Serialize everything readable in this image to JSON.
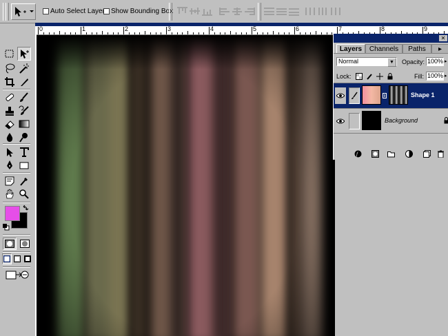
{
  "options_bar": {
    "auto_select_label": "Auto Select Layer",
    "show_bounding_label": "Show Bounding Box",
    "auto_select_checked": false,
    "show_bounding_checked": false
  },
  "ruler": {
    "numbers": [
      "0",
      "1",
      "2",
      "3",
      "4",
      "5",
      "6",
      "7",
      "8",
      "9"
    ]
  },
  "toolbox": {
    "foreground_color": "#e64ee8",
    "background_color": "#000000"
  },
  "layers_panel": {
    "tabs": [
      "Layers",
      "Channels",
      "Paths"
    ],
    "active_tab": "Layers",
    "blend_mode": "Normal",
    "opacity_label": "Opacity:",
    "opacity_value": "100%",
    "lock_label": "Lock:",
    "fill_label": "Fill:",
    "fill_value": "100%",
    "layers": [
      {
        "name": "Shape 1",
        "selected": true,
        "visible": true
      },
      {
        "name": "Background",
        "selected": false,
        "visible": true
      }
    ]
  },
  "colors": {
    "ui_gray": "#c0c0c0",
    "selection_blue": "#0a246a",
    "canvas_background": "#000000"
  }
}
